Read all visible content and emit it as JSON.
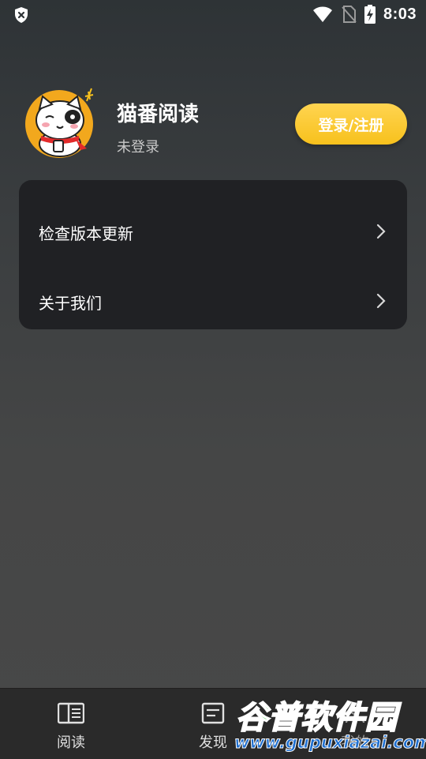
{
  "status_bar": {
    "time": "8:03",
    "icons": [
      "shield-x-icon",
      "wifi-icon",
      "no-sim-icon",
      "battery-charging-icon"
    ]
  },
  "profile": {
    "app_name": "猫番阅读",
    "login_status": "未登录",
    "login_button": "登录/注册",
    "avatar": "cat-avatar-icon"
  },
  "menu": {
    "items": [
      {
        "label": "检查版本更新",
        "icon": "chevron-right-icon"
      },
      {
        "label": "关于我们",
        "icon": "chevron-right-icon"
      }
    ]
  },
  "bottom_nav": {
    "items": [
      {
        "label": "阅读",
        "icon": "book-icon"
      },
      {
        "label": "发现",
        "icon": "list-icon"
      },
      {
        "label": "我的",
        "icon": "user-icon",
        "active": true
      }
    ]
  },
  "watermark": {
    "title": "谷普软件园",
    "url": "www.gupuxiazai.com"
  },
  "colors": {
    "accent": "#f7c11d",
    "card": "#202124",
    "nav_bg": "#2a2a2a"
  }
}
